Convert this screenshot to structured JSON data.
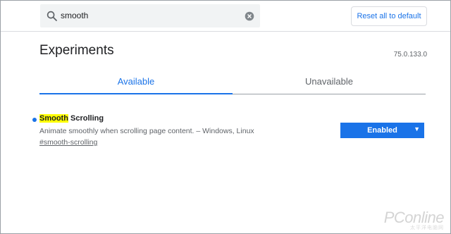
{
  "search": {
    "value": "smooth"
  },
  "header": {
    "reset_label": "Reset all to default"
  },
  "page": {
    "title": "Experiments",
    "version": "75.0.133.0"
  },
  "tabs": [
    {
      "label": "Available",
      "active": true
    },
    {
      "label": "Unavailable",
      "active": false
    }
  ],
  "experiment": {
    "title_highlight": "Smooth",
    "title_rest": " Scrolling",
    "description": "Animate smoothly when scrolling page content. – Windows, Linux",
    "link": "#smooth-scrolling",
    "state": "Enabled"
  },
  "colors": {
    "accent": "#1a73e8",
    "highlight": "#ffff00"
  },
  "watermark": {
    "logo": "PConline",
    "sub": "太平洋电脑网"
  },
  "icons": [
    "search-icon",
    "clear-icon",
    "dropdown-arrow-icon"
  ]
}
